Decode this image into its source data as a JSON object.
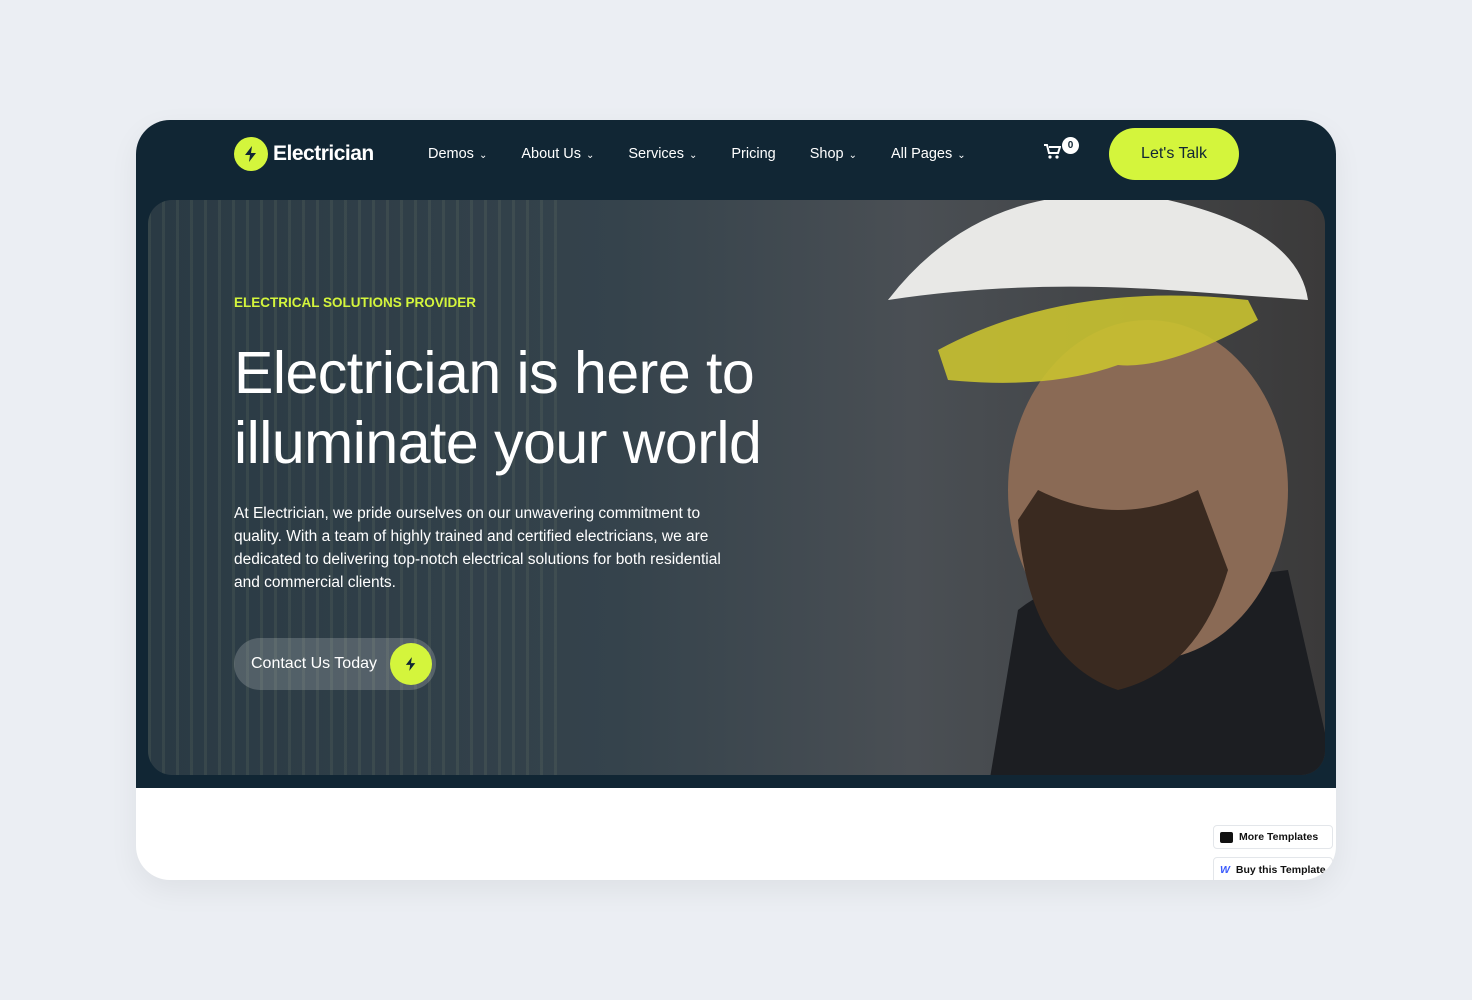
{
  "brand": {
    "name": "Electrician",
    "accent": "#d4f53c",
    "dark": "#112634"
  },
  "nav": {
    "items": [
      {
        "label": "Demos",
        "dropdown": true
      },
      {
        "label": "About Us",
        "dropdown": true
      },
      {
        "label": "Services",
        "dropdown": true
      },
      {
        "label": "Pricing",
        "dropdown": false
      },
      {
        "label": "Shop",
        "dropdown": true
      },
      {
        "label": "All Pages",
        "dropdown": true
      }
    ],
    "cart_count": "0",
    "cta": "Let's Talk"
  },
  "hero": {
    "kicker": "ELECTRICAL SOLUTIONS PROVIDER",
    "title": "Electrician is here to illuminate your world",
    "text": "At Electrician, we pride ourselves on our unwavering commitment to quality. With a team of highly trained and certified electricians, we are dedicated to delivering top-notch electrical solutions for both residential and commercial clients.",
    "button": "Contact Us Today"
  },
  "floating": {
    "more": "More Templates",
    "buy": "Buy this Template"
  }
}
